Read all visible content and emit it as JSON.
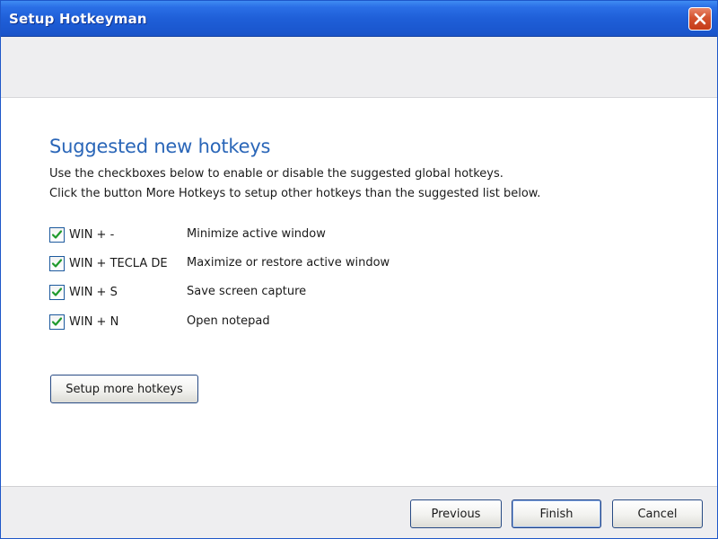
{
  "window": {
    "title": "Setup Hotkeyman"
  },
  "content": {
    "heading": "Suggested new hotkeys",
    "description_line1": "Use the checkboxes below to enable or disable the suggested global hotkeys.",
    "description_line2": "Click the button More Hotkeys to setup other hotkeys than the suggested list below.",
    "hotkeys": [
      {
        "key": "WIN + -",
        "description": "Minimize active window",
        "checked": true
      },
      {
        "key": "WIN + TECLA DE",
        "description": "Maximize or restore active window",
        "checked": true
      },
      {
        "key": "WIN + S",
        "description": "Save screen capture",
        "checked": true
      },
      {
        "key": "WIN + N",
        "description": "Open notepad",
        "checked": true
      }
    ],
    "more_button_label": "Setup more hotkeys"
  },
  "footer": {
    "previous_label": "Previous",
    "finish_label": "Finish",
    "cancel_label": "Cancel"
  },
  "colors": {
    "titlebar": "#1f5fd8",
    "heading": "#2a66b8",
    "check": "#1f9a2c",
    "close": "#d4532f"
  }
}
